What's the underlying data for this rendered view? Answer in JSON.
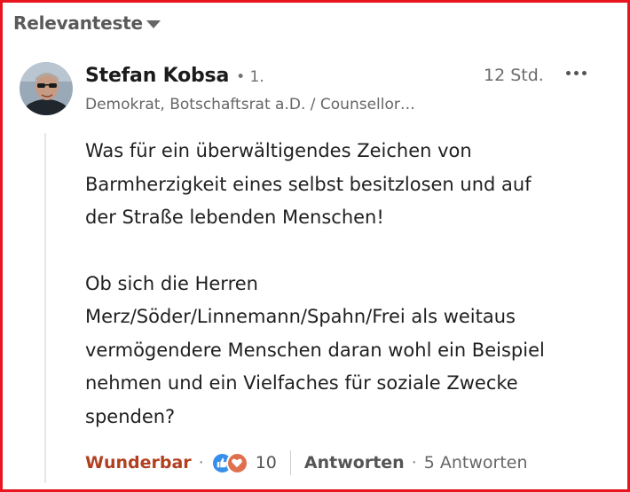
{
  "sort": {
    "label": "Relevanteste"
  },
  "comment": {
    "author": "Stefan Kobsa",
    "degree": "• 1.",
    "headline": "Demokrat, Botschaftsrat a.D. / Counsellor…",
    "time": "12 Std.",
    "paragraphs": [
      "Was für ein überwältigendes Zeichen von\nBarmherzigkeit eines selbst besitzlosen und auf\nder Straße lebenden Menschen!",
      "Ob sich die Herren\nMerz/Söder/Linnemann/Spahn/Frei als weitaus\nvermögendere Menschen daran wohl ein Beispiel\nnehmen und ein Vielfaches für soziale Zwecke\nspenden?"
    ]
  },
  "actions": {
    "reaction_label": "Wunderbar",
    "separator": "·",
    "reaction_count": "10",
    "reply_label": "Antworten",
    "replies_count": "5 Antworten"
  },
  "icons": {
    "sort": "caret-down-icon",
    "more": "more-horizontal-icon",
    "like": "thumbs-up-icon",
    "love": "heart-icon"
  },
  "colors": {
    "frame": "#e8141e",
    "reaction_accent": "#b24020",
    "like": "#378fe9",
    "love": "#df704d"
  }
}
